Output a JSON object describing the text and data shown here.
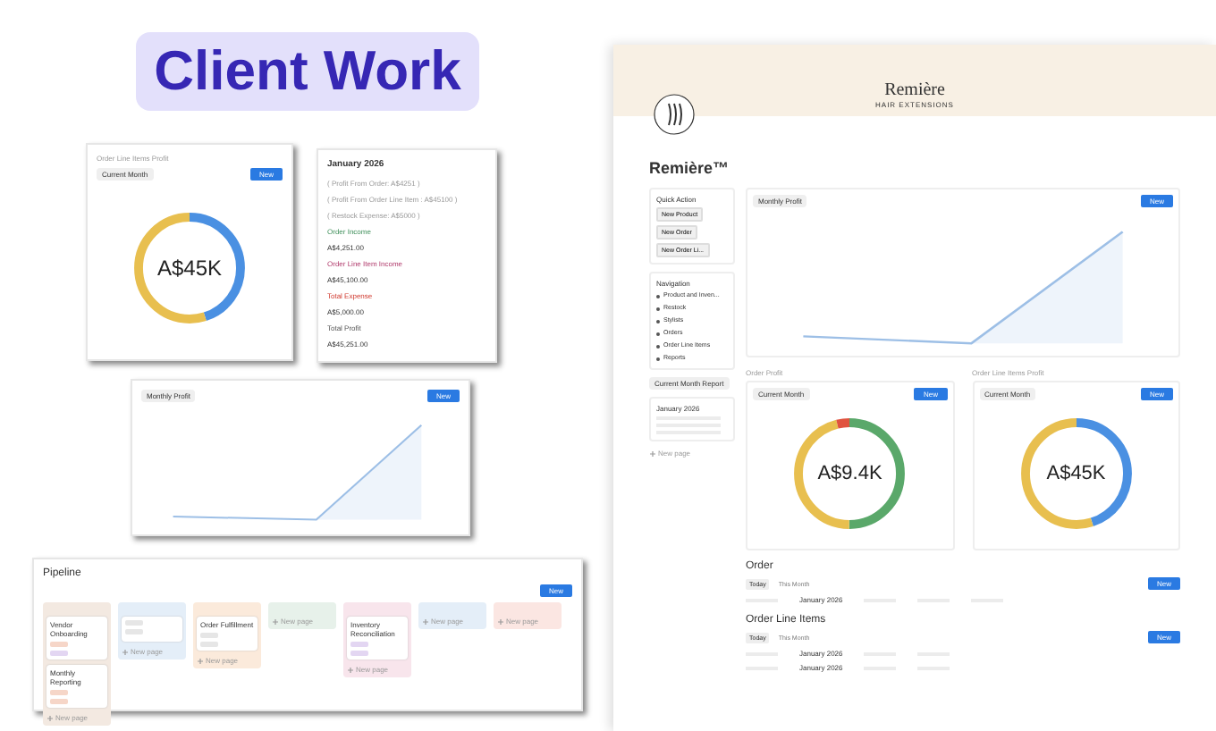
{
  "header": {
    "title": "Client Work"
  },
  "donut_card": {
    "title": "Order Line Items Profit",
    "filter": "Current Month",
    "button": "New",
    "value": "A$45K"
  },
  "summary_card": {
    "title": "January 2026",
    "lines": [
      {
        "kind": "note",
        "text": "( Profit From Order: A$4251 )"
      },
      {
        "kind": "note",
        "text": "( Profit From Order Line Item : A$45100 )"
      },
      {
        "kind": "note",
        "text": "( Restock Expense: A$5000 )"
      },
      {
        "kind": "income",
        "text": "Order Income"
      },
      {
        "kind": "value",
        "text": "A$4,251.00"
      },
      {
        "kind": "item_income",
        "text": "Order Line Item Income"
      },
      {
        "kind": "value",
        "text": "A$45,100.00"
      },
      {
        "kind": "expense",
        "text": "Total Expense"
      },
      {
        "kind": "value",
        "text": "A$5,000.00"
      },
      {
        "kind": "total",
        "text": "Total Profit"
      },
      {
        "kind": "value",
        "text": "A$45,251.00"
      }
    ]
  },
  "chart_card": {
    "title": "Monthly Profit",
    "button": "New"
  },
  "pipeline": {
    "title": "Pipeline",
    "button": "New",
    "columns": [
      {
        "color": "#f3e9e1",
        "cards": [
          {
            "title": "Vendor Onboarding",
            "tags": [
              {
                "color": "#f6d6c8"
              },
              {
                "color": "#e3d6f2"
              }
            ]
          },
          {
            "title": "Monthly Reporting",
            "tags": [
              {
                "color": "#f6d6c8"
              },
              {
                "color": "#f6d6c8"
              }
            ]
          }
        ],
        "add": "New page"
      },
      {
        "color": "#e4eef8",
        "cards": [
          {
            "tags": [
              {
                "color": "#e6e6e6"
              },
              {
                "color": "#e6e6e6"
              }
            ]
          }
        ],
        "add": "New page"
      },
      {
        "color": "#fbeadb",
        "cards": [
          {
            "title": "Order Fulfillment",
            "tags": [
              {
                "color": "#e6e6e6"
              },
              {
                "color": "#e6e6e6"
              }
            ]
          }
        ],
        "add": "New page"
      },
      {
        "color": "#e7f1ea",
        "add": "New page"
      },
      {
        "color": "#f8e5ec",
        "cards": [
          {
            "title": "Inventory Reconciliation",
            "tags": [
              {
                "color": "#e3d6f2"
              },
              {
                "color": "#e3d6f2"
              }
            ]
          }
        ],
        "add": "New page"
      },
      {
        "color": "#e4eef8",
        "add": "New page"
      },
      {
        "color": "#fbe6e2",
        "add": "New page"
      }
    ]
  },
  "brand_page": {
    "banner": {
      "name": "Remière",
      "tagline": "HAIR EXTENSIONS"
    },
    "title": "Remière™",
    "quick_action": {
      "title": "Quick Action",
      "buttons": [
        "New Product",
        "New Order",
        "New Order Li..."
      ]
    },
    "navigation": {
      "title": "Navigation",
      "items": [
        "Product and Inven...",
        "Restock",
        "Stylists",
        "Orders",
        "Order Line Items",
        "Reports"
      ]
    },
    "report": {
      "button": "Current Month Report",
      "title": "January 2026",
      "add": "New page"
    },
    "monthly_chart": {
      "title": "Monthly Profit",
      "button": "New"
    },
    "donuts": [
      {
        "title": "Order Profit",
        "filter": "Current Month",
        "button": "New",
        "value": "A$9.4K",
        "kind": "three"
      },
      {
        "title": "Order Line Items Profit",
        "filter": "Current Month",
        "button": "New",
        "value": "A$45K",
        "kind": "two"
      }
    ],
    "order": {
      "title": "Order",
      "views": [
        {
          "label": "Today",
          "selected": true
        },
        {
          "label": "This Month",
          "selected": false
        }
      ],
      "button": "New",
      "cell": "January 2026"
    },
    "order_line_items": {
      "title": "Order Line Items",
      "views": [
        {
          "label": "Today",
          "selected": true
        },
        {
          "label": "This Month",
          "selected": false
        }
      ],
      "button": "New",
      "cells": [
        "January 2026",
        "January 2026"
      ]
    }
  }
}
